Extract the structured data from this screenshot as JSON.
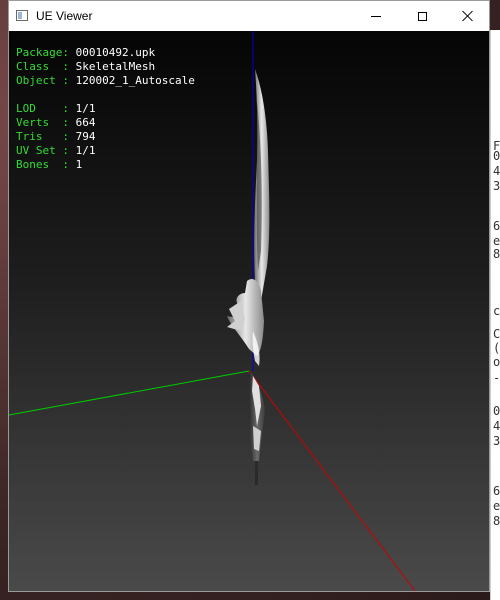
{
  "window": {
    "title": "UE Viewer",
    "icon": "app-window-icon"
  },
  "info": {
    "package_key": "Package: ",
    "package_value": "00010492.upk",
    "class_key": "Class  : ",
    "class_value": "SkeletalMesh",
    "object_key": "Object : ",
    "object_value": "120002_1_Autoscale",
    "lod_key": "LOD    : ",
    "lod_value": "1/1",
    "verts_key": "Verts  : ",
    "verts_value": "664",
    "tris_key": "Tris   : ",
    "tris_value": "794",
    "uvset_key": "UV Set : ",
    "uvset_value": "1/1",
    "bones_key": "Bones  : ",
    "bones_value": "1"
  },
  "side_panel": {
    "lines": [
      "F",
      "0",
      "4",
      "3",
      "6",
      "e",
      "8",
      "c",
      "C",
      "(",
      "o",
      "-",
      "0",
      "4",
      "3",
      "6",
      "e",
      "8"
    ]
  },
  "colors": {
    "label_green": "#33dd33",
    "value_white": "#ffffff",
    "axis_x": "#cc0000",
    "axis_y": "#00cc00",
    "axis_z": "#0000cc"
  }
}
